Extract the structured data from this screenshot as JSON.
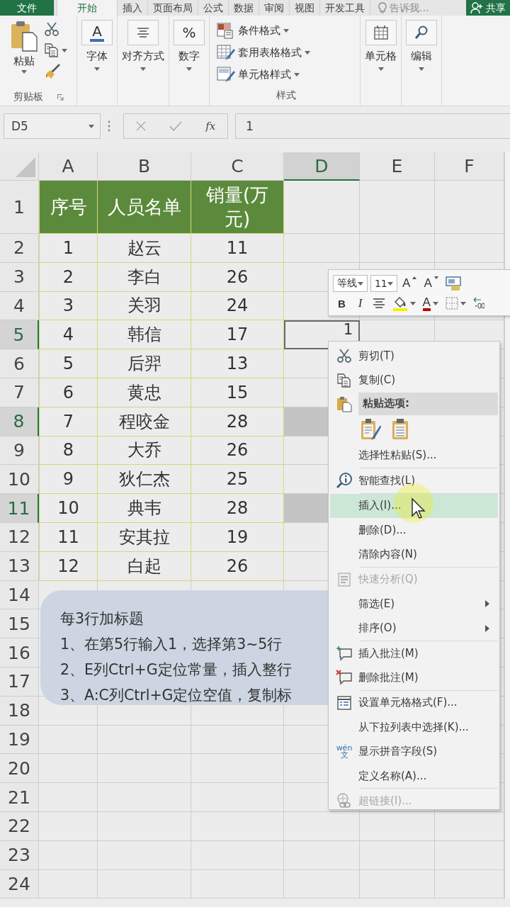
{
  "ribbon_tabs": [
    {
      "label": "文件",
      "kind": "file",
      "selected": false
    },
    {
      "label": "开始",
      "kind": "tab",
      "selected": true
    },
    {
      "label": "插入",
      "kind": "tab",
      "selected": false
    },
    {
      "label": "页面布局",
      "kind": "tab",
      "selected": false
    },
    {
      "label": "公式",
      "kind": "tab",
      "selected": false
    },
    {
      "label": "数据",
      "kind": "tab",
      "selected": false
    },
    {
      "label": "审阅",
      "kind": "tab",
      "selected": false
    },
    {
      "label": "视图",
      "kind": "tab",
      "selected": false
    },
    {
      "label": "开发工具",
      "kind": "tab",
      "selected": false
    },
    {
      "label": "告诉我...",
      "kind": "search",
      "selected": false
    },
    {
      "label": "共享",
      "kind": "share",
      "selected": false
    }
  ],
  "ribbon_groups": [
    {
      "kind": "clipboard",
      "button": "粘贴",
      "label": "剪贴板"
    },
    {
      "kind": "font",
      "glyph": "A",
      "button": "字体"
    },
    {
      "kind": "align",
      "button": "对齐方式"
    },
    {
      "kind": "number",
      "glyph": "%",
      "button": "数字"
    },
    {
      "kind": "styles",
      "items": [
        "条件格式",
        "套用表格格式",
        "单元格样式"
      ],
      "label": "样式"
    },
    {
      "kind": "cells",
      "button": "单元格"
    },
    {
      "kind": "editing",
      "button": "编辑"
    }
  ],
  "formula_bar": {
    "name_box": "D5",
    "function_button": "fx",
    "value": "1"
  },
  "columns": [
    {
      "label": "A",
      "selected": false
    },
    {
      "label": "B",
      "selected": false
    },
    {
      "label": "C",
      "selected": false
    },
    {
      "label": "D",
      "selected": true
    },
    {
      "label": "E",
      "selected": false
    },
    {
      "label": "F",
      "selected": false
    }
  ],
  "rows": [
    {
      "header": "1",
      "kind": "table-header",
      "selected": false,
      "active": false,
      "cells": [
        "序号",
        "人员名单",
        "销量(万元)"
      ]
    },
    {
      "header": "2",
      "kind": "table",
      "selected": false,
      "active": false,
      "cells": [
        "1",
        "赵云",
        "11"
      ]
    },
    {
      "header": "3",
      "kind": "table",
      "selected": false,
      "active": false,
      "cells": [
        "2",
        "李白",
        "26"
      ]
    },
    {
      "header": "4",
      "kind": "table",
      "selected": false,
      "active": false,
      "cells": [
        "3",
        "关羽",
        "24"
      ]
    },
    {
      "header": "5",
      "kind": "table",
      "selected": true,
      "active": true,
      "cells": [
        "4",
        "韩信",
        "17",
        "1"
      ]
    },
    {
      "header": "6",
      "kind": "table",
      "selected": false,
      "active": false,
      "cells": [
        "5",
        "后羿",
        "13"
      ]
    },
    {
      "header": "7",
      "kind": "table",
      "selected": false,
      "active": false,
      "cells": [
        "6",
        "黄忠",
        "15"
      ]
    },
    {
      "header": "8",
      "kind": "table",
      "selected": true,
      "active": false,
      "cells": [
        "7",
        "程咬金",
        "28"
      ]
    },
    {
      "header": "9",
      "kind": "table",
      "selected": false,
      "active": false,
      "cells": [
        "8",
        "大乔",
        "26"
      ]
    },
    {
      "header": "10",
      "kind": "table",
      "selected": false,
      "active": false,
      "cells": [
        "9",
        "狄仁杰",
        "25"
      ]
    },
    {
      "header": "11",
      "kind": "table",
      "selected": true,
      "active": false,
      "cells": [
        "10",
        "典韦",
        "28"
      ]
    },
    {
      "header": "12",
      "kind": "table",
      "selected": false,
      "active": false,
      "cells": [
        "11",
        "安其拉",
        "19"
      ]
    },
    {
      "header": "13",
      "kind": "table",
      "selected": false,
      "active": false,
      "cells": [
        "12",
        "白起",
        "26"
      ]
    },
    {
      "header": "14",
      "kind": "plain",
      "selected": false,
      "active": false
    },
    {
      "header": "15",
      "kind": "plain",
      "selected": false,
      "active": false
    },
    {
      "header": "16",
      "kind": "plain",
      "selected": false,
      "active": false
    },
    {
      "header": "17",
      "kind": "plain",
      "selected": false,
      "active": false
    },
    {
      "header": "18",
      "kind": "plain",
      "selected": false,
      "active": false
    },
    {
      "header": "19",
      "kind": "plain",
      "selected": false,
      "active": false
    },
    {
      "header": "20",
      "kind": "plain",
      "selected": false,
      "active": false
    },
    {
      "header": "21",
      "kind": "plain",
      "selected": false,
      "active": false
    },
    {
      "header": "22",
      "kind": "plain",
      "selected": false,
      "active": false
    },
    {
      "header": "23",
      "kind": "plain",
      "selected": false,
      "active": false
    },
    {
      "header": "24",
      "kind": "plain",
      "selected": false,
      "active": false
    }
  ],
  "note": {
    "title": "每3行加标题",
    "lines": [
      "1、在第5行输入1，选择第3~5行",
      "2、E列Ctrl+G定位常量，插入整行",
      "3、A:C列Ctrl+G定位空值，复制标"
    ]
  },
  "mini_toolbar": {
    "font": "等线",
    "size": "11",
    "row1": [
      {
        "kind": "grow",
        "label": "A"
      },
      {
        "kind": "shrink",
        "label": "A"
      },
      {
        "kind": "styles"
      }
    ],
    "row2": [
      {
        "kind": "bold",
        "label": "B"
      },
      {
        "kind": "italic",
        "label": "I"
      },
      {
        "kind": "center"
      },
      {
        "kind": "fill"
      },
      {
        "kind": "font-color",
        "label": "A"
      },
      {
        "kind": "borders"
      },
      {
        "kind": "decimal"
      }
    ]
  },
  "context_menu": {
    "items": [
      {
        "kind": "item",
        "label": "剪切(T)",
        "disabled": false,
        "selected": false
      },
      {
        "kind": "item",
        "label": "复制(C)",
        "disabled": false,
        "selected": false
      },
      {
        "kind": "header",
        "label": "粘贴选项:"
      },
      {
        "kind": "paste-options"
      },
      {
        "kind": "item",
        "label": "选择性粘贴(S)...",
        "disabled": false,
        "selected": false
      },
      {
        "kind": "separator"
      },
      {
        "kind": "item",
        "label": "智能查找(L)",
        "disabled": false,
        "selected": false
      },
      {
        "kind": "separator"
      },
      {
        "kind": "item",
        "label": "插入(I)...",
        "disabled": false,
        "selected": true
      },
      {
        "kind": "item",
        "label": "删除(D)...",
        "disabled": false,
        "selected": false
      },
      {
        "kind": "item",
        "label": "清除内容(N)",
        "disabled": false,
        "selected": false
      },
      {
        "kind": "separator"
      },
      {
        "kind": "item",
        "label": "快速分析(Q)",
        "disabled": true,
        "selected": false
      },
      {
        "kind": "item",
        "label": "筛选(E)",
        "disabled": false,
        "selected": false,
        "submenu": true
      },
      {
        "kind": "item",
        "label": "排序(O)",
        "disabled": false,
        "selected": false,
        "submenu": true
      },
      {
        "kind": "separator"
      },
      {
        "kind": "item",
        "label": "插入批注(M)",
        "disabled": false,
        "selected": false
      },
      {
        "kind": "item",
        "label": "删除批注(M)",
        "disabled": false,
        "selected": false
      },
      {
        "kind": "separator"
      },
      {
        "kind": "item",
        "label": "设置单元格格式(F)...",
        "disabled": false,
        "selected": false
      },
      {
        "kind": "item",
        "label": "从下拉列表中选择(K)...",
        "disabled": false,
        "selected": false
      },
      {
        "kind": "item",
        "icon_text": [
          "wén",
          "文"
        ],
        "label": "显示拼音字段(S)",
        "disabled": false,
        "selected": false
      },
      {
        "kind": "item",
        "label": "定义名称(A)...",
        "disabled": false,
        "selected": false
      },
      {
        "kind": "separator"
      },
      {
        "kind": "item",
        "label": "超链接(I)...",
        "disabled": true,
        "selected": false
      }
    ]
  }
}
